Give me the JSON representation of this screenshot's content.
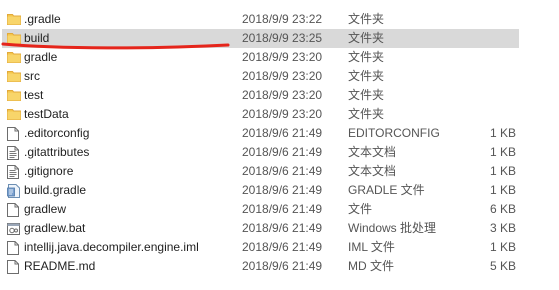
{
  "file_list": {
    "items": [
      {
        "name": ".gradle",
        "date": "2018/9/9 23:22",
        "type": "文件夹",
        "size": "",
        "icon": "folder-icon",
        "selected": false
      },
      {
        "name": "build",
        "date": "2018/9/9 23:25",
        "type": "文件夹",
        "size": "",
        "icon": "folder-icon",
        "selected": true
      },
      {
        "name": "gradle",
        "date": "2018/9/9 23:20",
        "type": "文件夹",
        "size": "",
        "icon": "folder-icon",
        "selected": false
      },
      {
        "name": "src",
        "date": "2018/9/9 23:20",
        "type": "文件夹",
        "size": "",
        "icon": "folder-icon",
        "selected": false
      },
      {
        "name": "test",
        "date": "2018/9/9 23:20",
        "type": "文件夹",
        "size": "",
        "icon": "folder-icon",
        "selected": false
      },
      {
        "name": "testData",
        "date": "2018/9/9 23:20",
        "type": "文件夹",
        "size": "",
        "icon": "folder-icon",
        "selected": false
      },
      {
        "name": ".editorconfig",
        "date": "2018/9/6 21:49",
        "type": "EDITORCONFIG",
        "size": "1 KB",
        "icon": "blank-file-icon",
        "selected": false
      },
      {
        "name": ".gitattributes",
        "date": "2018/9/6 21:49",
        "type": "文本文档",
        "size": "1 KB",
        "icon": "text-file-icon",
        "selected": false
      },
      {
        "name": ".gitignore",
        "date": "2018/9/6 21:49",
        "type": "文本文档",
        "size": "1 KB",
        "icon": "text-file-icon",
        "selected": false
      },
      {
        "name": "build.gradle",
        "date": "2018/9/6 21:49",
        "type": "GRADLE 文件",
        "size": "1 KB",
        "icon": "gradle-file-icon",
        "selected": false
      },
      {
        "name": "gradlew",
        "date": "2018/9/6 21:49",
        "type": "文件",
        "size": "6 KB",
        "icon": "blank-file-icon",
        "selected": false
      },
      {
        "name": "gradlew.bat",
        "date": "2018/9/6 21:49",
        "type": "Windows 批处理",
        "size": "3 KB",
        "icon": "batch-file-icon",
        "selected": false
      },
      {
        "name": "intellij.java.decompiler.engine.iml",
        "date": "2018/9/6 21:49",
        "type": "IML 文件",
        "size": "1 KB",
        "icon": "blank-file-icon",
        "selected": false
      },
      {
        "name": "README.md",
        "date": "2018/9/6 21:49",
        "type": "MD 文件",
        "size": "5 KB",
        "icon": "blank-file-icon",
        "selected": false
      }
    ]
  },
  "colors": {
    "folder": "#f4c64c",
    "folder_dark": "#e2a93a",
    "selection": "#d9d9d9",
    "annotation": "#e5251b"
  }
}
